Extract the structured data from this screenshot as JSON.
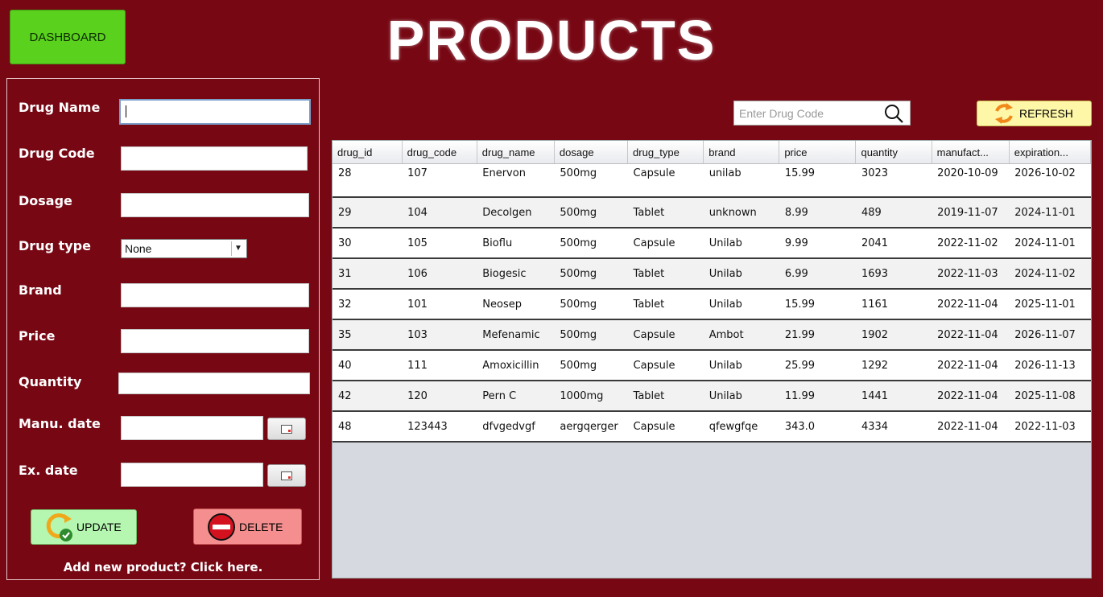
{
  "header": {
    "dashboard_label": "DASHBOARD",
    "title": "PRODUCTS"
  },
  "form": {
    "labels": {
      "drug_name": "Drug Name",
      "drug_code": "Drug Code",
      "dosage": "Dosage",
      "drug_type": "Drug type",
      "brand": "Brand",
      "price": "Price",
      "quantity": "Quantity",
      "manu_date": "Manu. date",
      "ex_date": "Ex. date"
    },
    "values": {
      "drug_name": "",
      "drug_code": "",
      "dosage": "",
      "brand": "",
      "price": "",
      "quantity": "",
      "manu_date": "",
      "ex_date": ""
    },
    "drug_type_selected": "None",
    "update_label": "UPDATE",
    "delete_label": "DELETE",
    "add_link": "Add new product? Click here."
  },
  "search": {
    "placeholder": "Enter Drug Code"
  },
  "refresh_label": "REFRESH",
  "table": {
    "columns": [
      "drug_id",
      "drug_code",
      "drug_name",
      "dosage",
      "drug_type",
      "brand",
      "price",
      "quantity",
      "manufact...",
      "expiration..."
    ],
    "rows": [
      [
        "28",
        "107",
        "Enervon",
        "500mg",
        "Capsule",
        "unilab",
        "15.99",
        "3023",
        "2020-10-09",
        "2026-10-02"
      ],
      [
        "29",
        "104",
        "Decolgen",
        "500mg",
        "Tablet",
        "unknown",
        "8.99",
        "489",
        "2019-11-07",
        "2024-11-01"
      ],
      [
        "30",
        "105",
        "Bioflu",
        "500mg",
        "Capsule",
        "Unilab",
        "9.99",
        "2041",
        "2022-11-02",
        "2024-11-01"
      ],
      [
        "31",
        "106",
        "Biogesic",
        "500mg",
        "Tablet",
        "Unilab",
        "6.99",
        "1693",
        "2022-11-03",
        "2024-11-02"
      ],
      [
        "32",
        "101",
        "Neosep",
        "500mg",
        "Tablet",
        "Unilab",
        "15.99",
        "1161",
        "2022-11-04",
        "2025-11-01"
      ],
      [
        "35",
        "103",
        "Mefenamic",
        "500mg",
        "Capsule",
        "Ambot",
        "21.99",
        "1902",
        "2022-11-04",
        "2026-11-07"
      ],
      [
        "40",
        "111",
        "Amoxicillin",
        "500mg",
        "Capsule",
        "Unilab",
        "25.99",
        "1292",
        "2022-11-04",
        "2026-11-13"
      ],
      [
        "42",
        "120",
        "Pern C",
        "1000mg",
        "Tablet",
        "Unilab",
        "11.99",
        "1441",
        "2022-11-04",
        "2025-11-08"
      ],
      [
        "48",
        "123443",
        "dfvgedvgf",
        "aergqerger",
        "Capsule",
        "qfewgfqe",
        "343.0",
        "4334",
        "2022-11-04",
        "2022-11-03"
      ]
    ]
  },
  "colors": {
    "background": "#760713",
    "dashboard_button": "#5ad11c",
    "update_button": "#b5f7b0",
    "delete_button": "#f58e8e",
    "refresh_button": "#fff7a8"
  }
}
